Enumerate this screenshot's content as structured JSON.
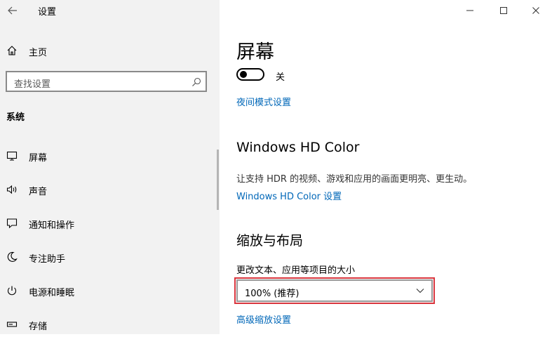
{
  "window": {
    "title": "设置",
    "back_icon": "arrow-left-icon",
    "minimize_icon": "minimize-icon",
    "maximize_icon": "maximize-icon",
    "close_icon": "close-icon"
  },
  "sidebar": {
    "home": {
      "label": "主页",
      "icon": "home-icon"
    },
    "search": {
      "placeholder": "查找设置",
      "icon": "search-icon"
    },
    "section_label": "系统",
    "items": [
      {
        "label": "屏幕",
        "icon": "monitor-icon"
      },
      {
        "label": "声音",
        "icon": "speaker-icon"
      },
      {
        "label": "通知和操作",
        "icon": "notification-icon"
      },
      {
        "label": "专注助手",
        "icon": "moon-icon"
      },
      {
        "label": "电源和睡眠",
        "icon": "power-icon"
      },
      {
        "label": "存储",
        "icon": "storage-icon"
      }
    ]
  },
  "main": {
    "title": "屏幕",
    "night_light": {
      "toggle_state": "关",
      "link": "夜间模式设置"
    },
    "hd_color": {
      "heading": "Windows HD Color",
      "description": "让支持 HDR 的视频、游戏和应用的画面更明亮、更生动。",
      "link": "Windows HD Color 设置"
    },
    "scale_layout": {
      "heading": "缩放与布局",
      "label": "更改文本、应用等项目的大小",
      "selected_value": "100% (推荐)",
      "link": "高级缩放设置"
    }
  },
  "colors": {
    "link": "#0067b8",
    "sidebar_bg": "#f2f2f2",
    "highlight_border": "#d9363e"
  }
}
